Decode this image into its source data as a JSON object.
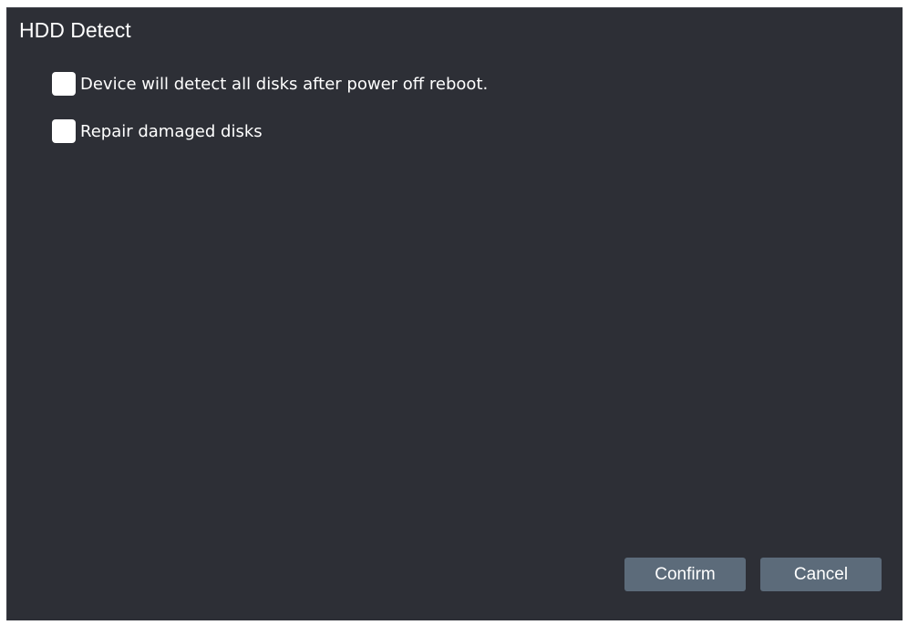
{
  "dialog": {
    "title": "HDD Detect",
    "options": [
      {
        "label": "Device will detect all disks after power off reboot.",
        "checked": false
      },
      {
        "label": "Repair damaged disks",
        "checked": false
      }
    ],
    "buttons": {
      "confirm": "Confirm",
      "cancel": "Cancel"
    }
  },
  "colors": {
    "background": "#2d2f36",
    "button": "#5c6b7a",
    "text": "#ffffff"
  }
}
